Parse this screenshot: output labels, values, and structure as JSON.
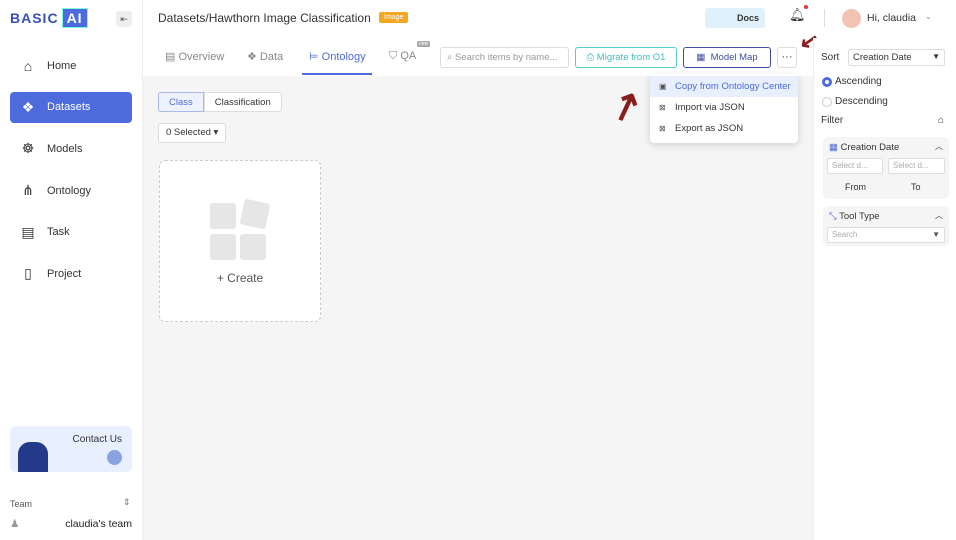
{
  "sidebar": {
    "logo_text": "BASIC",
    "logo_ai": "AI",
    "items": [
      {
        "label": "Home",
        "icon": "home-icon"
      },
      {
        "label": "Datasets",
        "icon": "datasets-icon"
      },
      {
        "label": "Models",
        "icon": "brain-icon"
      },
      {
        "label": "Ontology",
        "icon": "hierarchy-icon"
      },
      {
        "label": "Task",
        "icon": "clipboard-icon"
      },
      {
        "label": "Project",
        "icon": "file-icon"
      }
    ],
    "contact": "Contact Us",
    "team_label": "Team",
    "team_name": "claudia's team"
  },
  "header": {
    "breadcrumb": "Datasets/Hawthorn Image Classification",
    "badge": "Image",
    "docs": "Docs",
    "user": "Hi, claudia"
  },
  "tabs": [
    {
      "label": "Overview"
    },
    {
      "label": "Data"
    },
    {
      "label": "Ontology"
    },
    {
      "label": "QA"
    }
  ],
  "tab_new_badge": "new",
  "toolbar": {
    "search_placeholder": "Search items by name...",
    "migrate": "Migrate from O1",
    "model_map": "Model Map",
    "more": "···"
  },
  "menu": [
    "Copy from Ontology Center",
    "Import via JSON",
    "Export as JSON"
  ],
  "main": {
    "seg": [
      "Class",
      "Classification"
    ],
    "selected": "0 Selected",
    "create": "+ Create"
  },
  "right": {
    "sort_label": "Sort",
    "sort_value": "Creation Date",
    "asc": "Ascending",
    "desc": "Descending",
    "filter": "Filter",
    "date_panel": "Creation Date",
    "date_from_ph": "Select d...",
    "date_to_ph": "Select d...",
    "from": "From",
    "to": "To",
    "tool_panel": "Tool Type",
    "tool_ph": "Search"
  },
  "colors": {
    "accent": "#4d6bdc",
    "badge": "#f5a623",
    "annotation": "#8a1e1e"
  }
}
